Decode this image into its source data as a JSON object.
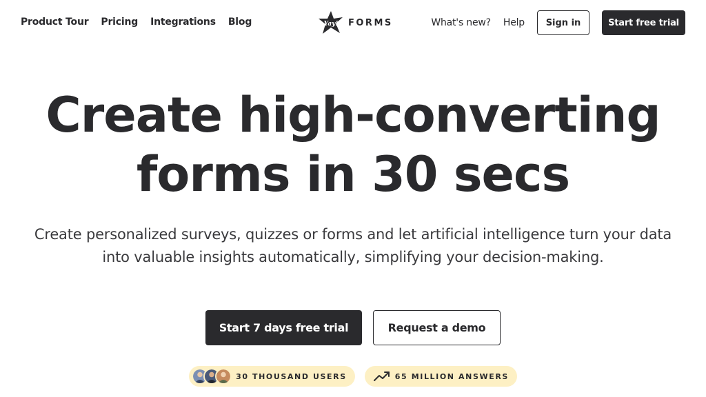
{
  "nav": {
    "links": [
      "Product Tour",
      "Pricing",
      "Integrations",
      "Blog"
    ],
    "logo_text": "FORMS",
    "logo_script": "Yay!",
    "whats_new": "What's new?",
    "help": "Help",
    "sign_in": "Sign in",
    "start_trial": "Start free trial"
  },
  "hero": {
    "title_line1": "Create high-converting",
    "title_line2": "forms in 30 secs",
    "subtitle_line1": "Create personalized surveys, quizzes or forms and let artificial intelligence turn your data",
    "subtitle_line2": "into valuable insights automatically, simplifying your decision-making."
  },
  "cta": {
    "primary": "Start 7 days free trial",
    "secondary": "Request a demo"
  },
  "badges": {
    "users": "30 THOUSAND USERS",
    "answers": "65 MILLION ANSWERS",
    "avatar_colors": [
      "#7b8fb3",
      "#4a5a78",
      "#c58a5e"
    ],
    "trend_icon": "trending-up-icon"
  },
  "colors": {
    "dark": "#2a2a2d",
    "badge_bg": "#fdf0c4",
    "background": "#ffffff"
  }
}
